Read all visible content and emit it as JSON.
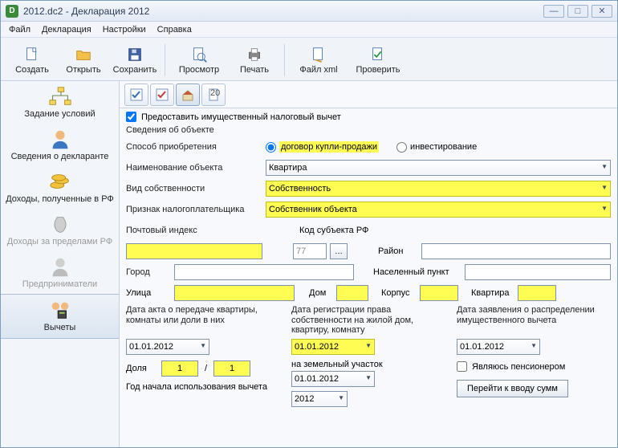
{
  "window": {
    "title": "2012.dc2 - Декларация 2012"
  },
  "menu": {
    "file": "Файл",
    "decl": "Декларация",
    "settings": "Настройки",
    "help": "Справка"
  },
  "toolbar": {
    "create": "Создать",
    "open": "Открыть",
    "save": "Сохранить",
    "view": "Просмотр",
    "print": "Печать",
    "xml": "Файл xml",
    "check": "Проверить"
  },
  "sidebar": {
    "conditions": "Задание условий",
    "declarant": "Сведения о декларанте",
    "income_rf": "Доходы, полученные в РФ",
    "income_abroad": "Доходы за пределами РФ",
    "entrepreneurs": "Предприниматели",
    "deductions": "Вычеты"
  },
  "tabs": {
    "last": "20…"
  },
  "form": {
    "provide_checkbox": "Предоставить имущественный налоговый вычет",
    "object_section": "Сведения об объекте",
    "acq_method": "Способ приобретения",
    "acq_sale": "договор купли-продажи",
    "acq_invest": "инвестирование",
    "obj_name": "Наименование объекта",
    "obj_name_val": "Квартира",
    "own_type": "Вид собственности",
    "own_type_val": "Собственность",
    "taxpayer_sign": "Признак налогоплательщика",
    "taxpayer_sign_val": "Собственник объекта",
    "postal": "Почтовый индекс",
    "region_code": "Код субъекта РФ",
    "region_code_val": "77",
    "district": "Район",
    "city": "Город",
    "settlement": "Населенный пункт",
    "street": "Улица",
    "house": "Дом",
    "building": "Корпус",
    "flat": "Квартира",
    "col1": "Дата акта о передаче квартиры, комнаты или доли в них",
    "col2": "Дата регистрации права собственности на жилой дом, квартиру, комнату",
    "col3": "Дата заявления о распределении имущественного вычета",
    "date1": "01.01.2012",
    "land_label": "на земельный участок",
    "date_land": "01.01.2012",
    "date3": "01.01.2012",
    "share_label": "Доля",
    "share_a": "1",
    "share_b": "1",
    "share_sep": "/",
    "pensioner": "Являюсь пенсионером",
    "year_label": "Год начала использования вычета",
    "year_val": "2012",
    "go_button": "Перейти к вводу сумм"
  }
}
